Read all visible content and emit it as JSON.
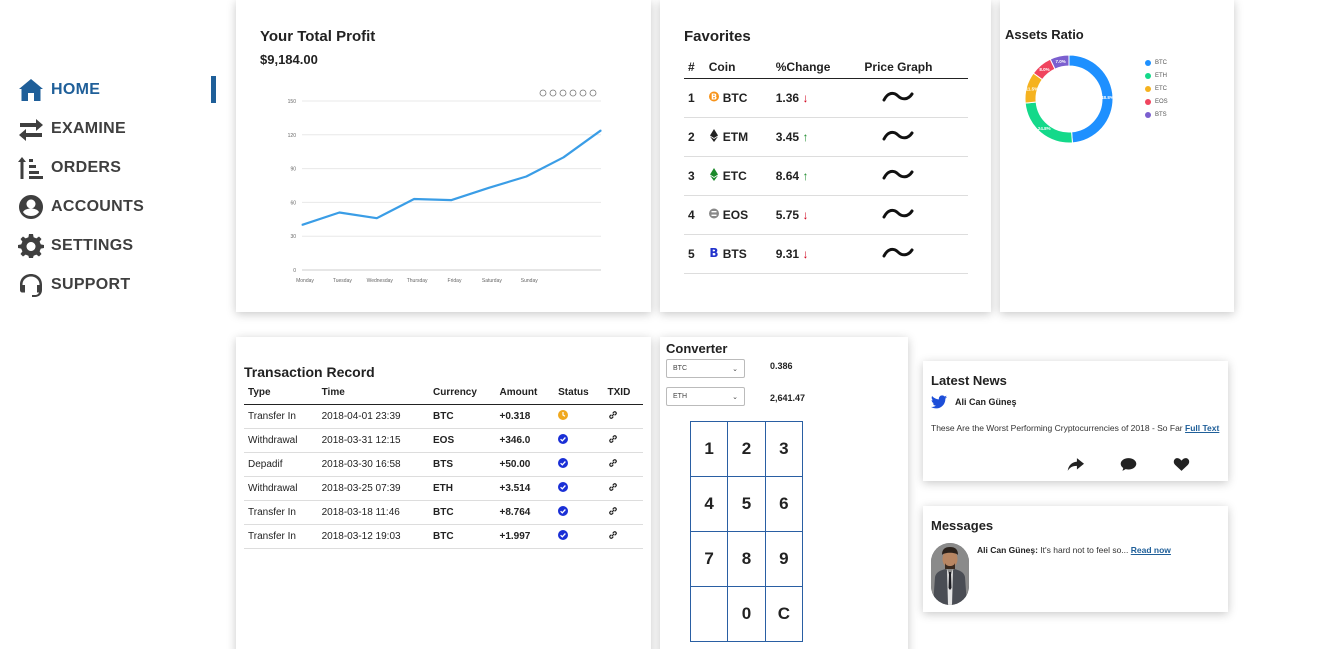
{
  "sidebar": {
    "items": [
      {
        "label": "HOME",
        "icon": "home-icon",
        "active": true
      },
      {
        "label": "EXAMINE",
        "icon": "exchange-icon"
      },
      {
        "label": "ORDERS",
        "icon": "sort-icon"
      },
      {
        "label": "ACCOUNTS",
        "icon": "user-circle-icon"
      },
      {
        "label": "SETTINGS",
        "icon": "gear-icon"
      },
      {
        "label": "SUPPORT",
        "icon": "headset-icon"
      }
    ],
    "accent": "#1f5f99"
  },
  "profit": {
    "title": "Your Total Profit",
    "value": "$9,184.00"
  },
  "chart_data": {
    "type": "line",
    "categories": [
      "Monday",
      "Tuesday",
      "Wednesday",
      "Thursday",
      "Friday",
      "Saturday",
      "Sunday",
      "",
      ""
    ],
    "series": [
      {
        "values": [
          40,
          51,
          46,
          63,
          62,
          73,
          83,
          100,
          124
        ]
      }
    ],
    "yticks": [
      "0",
      "30",
      "60",
      "90",
      "120",
      "150"
    ],
    "ylim": [
      0,
      150
    ],
    "grid": true,
    "color": "#3a9de6"
  },
  "favorites": {
    "title": "Favorites",
    "headers": [
      "#",
      "Coin",
      "%Change",
      "Price Graph"
    ],
    "rows": [
      {
        "n": "1",
        "coin": "BTC",
        "change": "1.36",
        "dir": "down",
        "icon": "bitcoin-icon",
        "color": "#f7931a"
      },
      {
        "n": "2",
        "coin": "ETM",
        "change": "3.45",
        "dir": "up",
        "icon": "ethereum-icon",
        "color": "#222222"
      },
      {
        "n": "3",
        "coin": "ETC",
        "change": "8.64",
        "dir": "up",
        "icon": "ethereum-classic-icon",
        "color": "#1a8a2a"
      },
      {
        "n": "4",
        "coin": "EOS",
        "change": "5.75",
        "dir": "down",
        "icon": "eos-icon",
        "color": "#888888"
      },
      {
        "n": "5",
        "coin": "BTS",
        "change": "9.31",
        "dir": "down",
        "icon": "bitshares-icon",
        "color": "#2233cc"
      }
    ]
  },
  "assets": {
    "title": "Assets Ratio",
    "slices": [
      {
        "name": "BTC",
        "value": 48.8,
        "label": "48.8%",
        "color": "#1e90ff"
      },
      {
        "name": "ETH",
        "value": 24.8,
        "label": "24.8%",
        "color": "#14d98a"
      },
      {
        "name": "ETC",
        "value": 11.5,
        "label": "11.5%",
        "color": "#f5b21f"
      },
      {
        "name": "EOS",
        "value": 8.0,
        "label": "8.0%",
        "color": "#f0445e"
      },
      {
        "name": "BTS",
        "value": 7.0,
        "label": "7.0%",
        "color": "#7b5fcf"
      }
    ]
  },
  "transactions": {
    "title": "Transaction Record",
    "headers": [
      "Type",
      "Time",
      "Currency",
      "Amount",
      "Status",
      "TXID"
    ],
    "rows": [
      {
        "type": "Transfer In",
        "time": "2018-04-01 23:39",
        "currency": "BTC",
        "amount": "+0.318",
        "status": "pending"
      },
      {
        "type": "Withdrawal",
        "time": "2018-03-31 12:15",
        "currency": "EOS",
        "amount": "+346.0",
        "status": "done"
      },
      {
        "type": "Depadif",
        "time": "2018-03-30 16:58",
        "currency": "BTS",
        "amount": "+50.00",
        "status": "done"
      },
      {
        "type": "Withdrawal",
        "time": "2018-03-25 07:39",
        "currency": "ETH",
        "amount": "+3.514",
        "status": "done"
      },
      {
        "type": "Transfer In",
        "time": "2018-03-18 11:46",
        "currency": "BTC",
        "amount": "+8.764",
        "status": "done"
      },
      {
        "type": "Transfer In",
        "time": "2018-03-12 19:03",
        "currency": "BTC",
        "amount": "+1.997",
        "status": "done"
      }
    ]
  },
  "converter": {
    "title": "Converter",
    "from": {
      "currency": "BTC",
      "value": "0.386"
    },
    "to": {
      "currency": "ETH",
      "value": "2,641.47"
    },
    "keys": [
      [
        "1",
        "2",
        "3"
      ],
      [
        "4",
        "5",
        "6"
      ],
      [
        "7",
        "8",
        "9"
      ],
      [
        "",
        "0",
        "C"
      ]
    ]
  },
  "news": {
    "title": "Latest News",
    "author": "Ali Can Güneş",
    "text": "These Are the Worst Performing Cryptocurrencies of 2018 - So Far",
    "link": "Full Text"
  },
  "messages": {
    "title": "Messages",
    "sender": "Ali Can Güneş:",
    "text": "It's hard not to feel so...",
    "link": "Read now"
  }
}
